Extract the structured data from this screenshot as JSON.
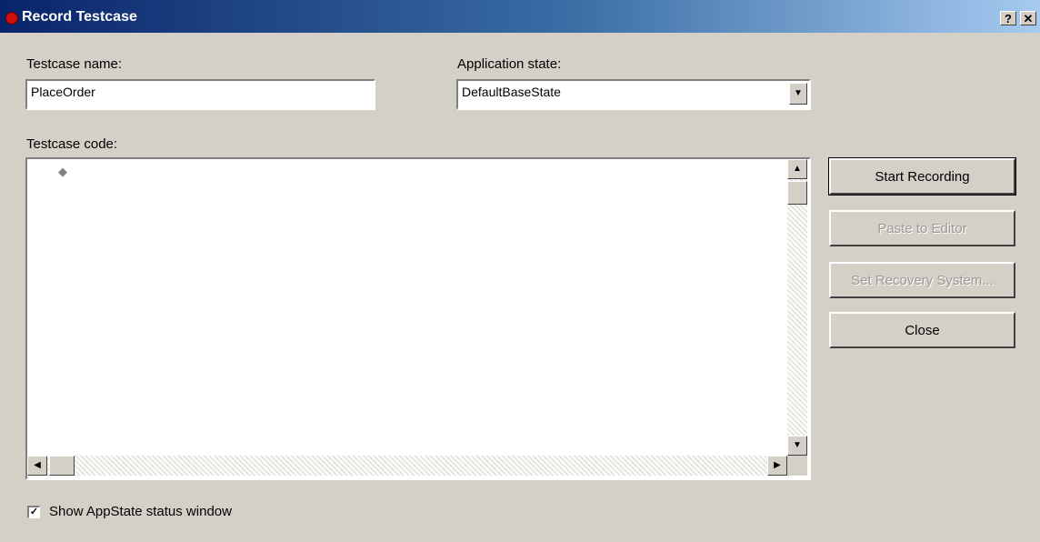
{
  "window": {
    "title": "Record Testcase",
    "help_label": "?",
    "close_label": "✕"
  },
  "form": {
    "testcase_name_label": "Testcase name:",
    "testcase_name_value": "PlaceOrder",
    "app_state_label": "Application state:",
    "app_state_value": "DefaultBaseState",
    "testcase_code_label": "Testcase code:",
    "show_appstate_label": "Show AppState status window",
    "show_appstate_checked": true
  },
  "buttons": {
    "start_recording": "Start Recording",
    "paste_to_editor": "Paste to Editor",
    "set_recovery_system": "Set Recovery System...",
    "close": "Close"
  },
  "icons": {
    "title": "record-dot-icon",
    "dropdown": "chevron-down-icon",
    "scroll_up": "arrow-up-icon",
    "scroll_down": "arrow-down-icon",
    "scroll_left": "arrow-left-icon",
    "scroll_right": "arrow-right-icon",
    "check": "checkmark-icon"
  },
  "colors": {
    "titlebar_start": "#0a246a",
    "titlebar_end": "#a6caf0",
    "record_dot": "#d01010",
    "dialog_bg": "#d4d0c8"
  }
}
